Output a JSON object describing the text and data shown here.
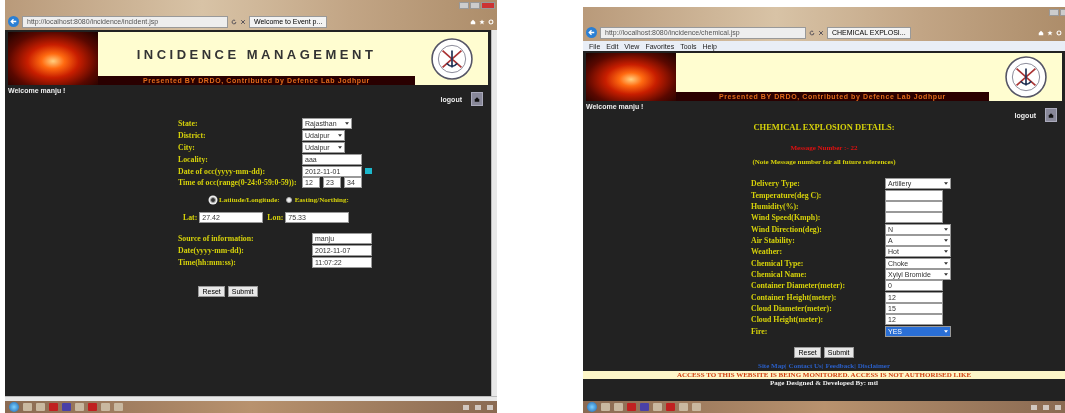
{
  "windows": [
    {
      "browser": {
        "url": "http://localhost:8080/incidence/incident.jsp",
        "tab": "Welcome to Event p..."
      },
      "header": {
        "title": "INCIDENCE MANAGEMENT",
        "subtitle": "Presented BY DRDO, Contributed by Defence Lab Jodhpur"
      },
      "welcome": "Welcome manju !",
      "logout": "logout",
      "sections": [
        {
          "kind": "form",
          "fields": [
            {
              "label": "State:",
              "kind": "select",
              "value": "Rajasthan"
            },
            {
              "label": "District:",
              "kind": "select",
              "value": "Udaipur"
            },
            {
              "label": "City:",
              "kind": "select",
              "value": "Udaipur"
            },
            {
              "label": "Locality:",
              "kind": "text",
              "value": "aaa"
            },
            {
              "label": "Date of occ(yyyy-mm-dd):",
              "kind": "date",
              "value": "2012-11-01"
            },
            {
              "label": "Time of occ(range(0-24:0-59:0-59)):",
              "kind": "time",
              "parts": [
                "12",
                "23",
                "34"
              ]
            }
          ]
        },
        {
          "kind": "radio",
          "options": [
            {
              "label": "Latitude/Longitude:",
              "selected": true
            },
            {
              "label": "Easting/Northing:",
              "selected": false
            }
          ]
        },
        {
          "kind": "coords",
          "lat_label": "Lat:",
          "lat": "27.42",
          "lon_label": "Lon:",
          "lon": "75.33"
        },
        {
          "kind": "form",
          "fields": [
            {
              "label": "Source of information:",
              "kind": "text",
              "value": "manju"
            },
            {
              "label": "Date(yyyy-mm-dd):",
              "kind": "text",
              "value": "2012-11-07"
            },
            {
              "label": "Time(hh:mm:ss):",
              "kind": "text",
              "value": "11:07:22"
            }
          ]
        },
        {
          "kind": "buttons",
          "buttons": [
            "Reset",
            "Submit"
          ]
        }
      ]
    },
    {
      "browser": {
        "url": "http://localhost:8080/incidence/chemical.jsp",
        "tab": "CHEMICAL EXPLOSI...",
        "menu": [
          "File",
          "Edit",
          "View",
          "Favorites",
          "Tools",
          "Help"
        ]
      },
      "header": {
        "subtitle": "Presented BY DRDO, Contributed by Defence Lab Jodhpur"
      },
      "welcome": "Welcome manju !",
      "logout": "logout",
      "sections": [
        {
          "kind": "heading",
          "text": "CHEMICAL EXPLOSION DETAILS:"
        },
        {
          "kind": "message",
          "text": "Message Number :- 22"
        },
        {
          "kind": "note",
          "text": "(Note Message number for all future references)"
        },
        {
          "kind": "form",
          "fields": [
            {
              "label": "Delivery Type:",
              "kind": "select",
              "value": "Artillery"
            },
            {
              "label": "Temperature(deg C):",
              "kind": "text"
            },
            {
              "label": "Humidity(%):",
              "kind": "text"
            },
            {
              "label": "Wind Speed(Kmph):",
              "kind": "text"
            },
            {
              "label": "Wind Direction(deg):",
              "kind": "select",
              "value": "N"
            },
            {
              "label": "Air Stability:",
              "kind": "select",
              "value": "A"
            },
            {
              "label": "Weather:",
              "kind": "select",
              "value": "Hot"
            },
            {
              "label": "Chemical Type:",
              "kind": "select",
              "value": "Choke"
            },
            {
              "label": "Chemical Name:",
              "kind": "select",
              "value": "Xylyl Bromide"
            },
            {
              "label": "Container Diameter(meter):",
              "kind": "text",
              "value": "0"
            },
            {
              "label": "Container Height(meter):",
              "kind": "text",
              "value": "12"
            },
            {
              "label": "Cloud Diameter(meter):",
              "kind": "text",
              "value": "15"
            },
            {
              "label": "Cloud Height(meter):",
              "kind": "text",
              "value": "12"
            },
            {
              "label": "Fire:",
              "kind": "select",
              "value": "YES",
              "highlighted": true
            }
          ]
        },
        {
          "kind": "buttons",
          "buttons": [
            "Reset",
            "Submit"
          ]
        },
        {
          "kind": "footer",
          "links": [
            "Site Map|",
            "Contact Us|",
            "Feedback|",
            "Disclaimer"
          ],
          "warning": "ACCESS TO THIS WEBSITE IS BEING MONITORED. ACCESS IS NOT AUTHORISED LIKE",
          "credit": "Page Designed & Developed By: mtl"
        }
      ]
    }
  ]
}
